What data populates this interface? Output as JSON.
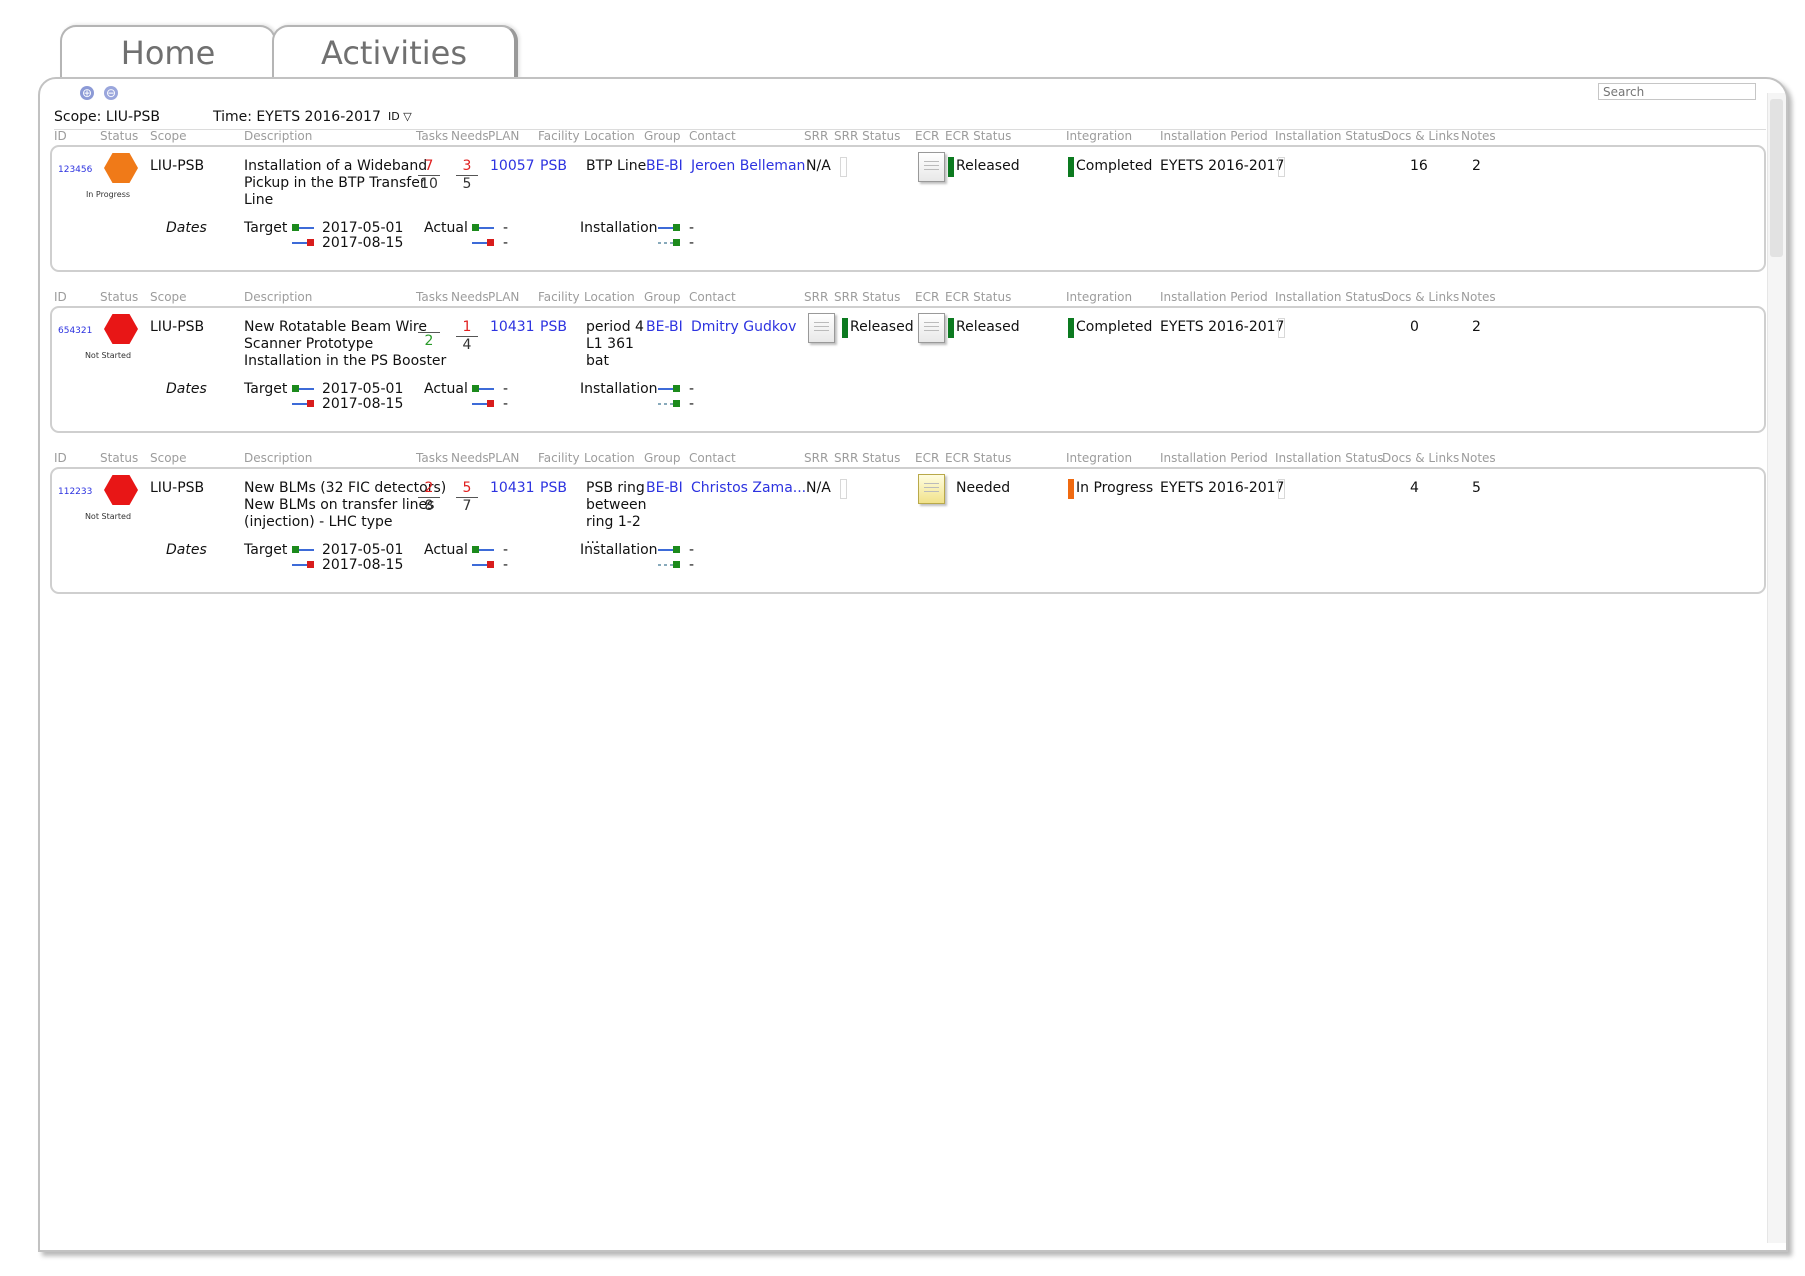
{
  "tabs": [
    {
      "label": "Home"
    },
    {
      "label": "Activities"
    }
  ],
  "toolbar": {
    "expand_all": "⊕",
    "collapse_all": "⊖",
    "search_placeholder": "Search"
  },
  "filters": {
    "scope": "Scope: LIU-PSB",
    "time": "Time: EYETS 2016-2017",
    "sort": "ID ▽"
  },
  "columns": [
    "ID",
    "Status",
    "Scope",
    "Description",
    "Tasks",
    "Needs",
    "PLAN",
    "Facility",
    "Location",
    "Group",
    "Contact",
    "SRR",
    "SRR Status",
    "ECR",
    "ECR Status",
    "Integration",
    "Installation Period",
    "Installation Status",
    "Docs & Links",
    "Notes"
  ],
  "labels": {
    "dates": "Dates",
    "target": "Target",
    "actual": "Actual",
    "installation": "Installation",
    "dash": "-"
  },
  "colors": {
    "link": "#2d33e0",
    "released": "#0c7a20",
    "completed": "#0c7a20",
    "in_progress": "#f06a10",
    "hex_orange": "#f07a18",
    "hex_red": "#e81616"
  },
  "activities": [
    {
      "id": "123456",
      "status": "In Progress",
      "status_color": "#f07a18",
      "scope": "LIU-PSB",
      "description": [
        "Installation of a Wideband",
        "Pickup in the BTP Transfer",
        "Line"
      ],
      "tasks_num": "7",
      "tasks_den": "10",
      "needs_num": "3",
      "needs_den": "5",
      "plan": "10057",
      "facility": "PSB",
      "location": [
        "BTP Line"
      ],
      "group": "BE-BI",
      "contact": "Jeroen Belleman",
      "srr": "N/A",
      "srr_status": "",
      "ecr_status": "Released",
      "integration": "Completed",
      "installation_period": "EYETS 2016-2017",
      "docs": "16",
      "notes": "2",
      "target_start": "2017-05-01",
      "target_end": "2017-08-15"
    },
    {
      "id": "654321",
      "status": "Not Started",
      "status_color": "#e81616",
      "scope": "LIU-PSB",
      "description": [
        "New Rotatable Beam Wire",
        "Scanner Prototype",
        "Installation in the PS Booster"
      ],
      "tasks_num": "",
      "tasks_den": "2",
      "needs_num": "1",
      "needs_den": "4",
      "plan": "10431",
      "facility": "PSB",
      "location": [
        "period 4",
        "L1 361",
        "bat"
      ],
      "group": "BE-BI",
      "contact": "Dmitry Gudkov",
      "srr": "",
      "srr_status": "Released",
      "ecr_status": "Released",
      "integration": "Completed",
      "installation_period": "EYETS 2016-2017",
      "docs": "0",
      "notes": "2",
      "target_start": "2017-05-01",
      "target_end": "2017-08-15"
    },
    {
      "id": "112233",
      "status": "Not Started",
      "status_color": "#e81616",
      "scope": "LIU-PSB",
      "description": [
        "New BLMs (32 FIC detectors)",
        "New BLMs on transfer lines",
        "(injection) - LHC type"
      ],
      "tasks_num": "2",
      "tasks_den": "8",
      "needs_num": "5",
      "needs_den": "7",
      "plan": "10431",
      "facility": "PSB",
      "location": [
        "PSB ring",
        "between",
        "ring 1-2",
        "..."
      ],
      "group": "BE-BI",
      "contact": "Christos Zama...",
      "srr": "N/A",
      "srr_status": "",
      "ecr_status": "Needed",
      "integration": "In Progress",
      "installation_period": "EYETS 2016-2017",
      "docs": "4",
      "notes": "5",
      "target_start": "2017-05-01",
      "target_end": "2017-08-15"
    }
  ]
}
